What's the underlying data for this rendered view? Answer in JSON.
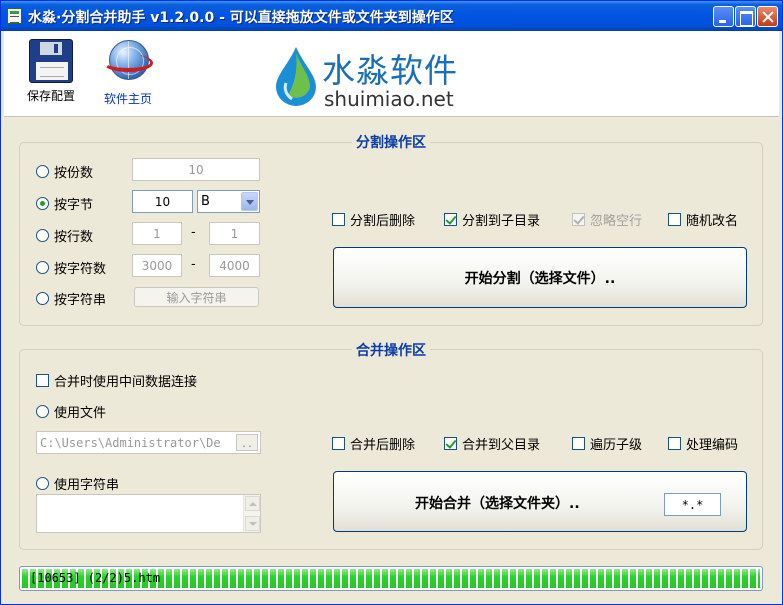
{
  "window": {
    "title": "水淼·分割合并助手 v1.2.0.0 - 可以直接拖放文件或文件夹到操作区"
  },
  "toolbar": {
    "save_label": "保存配置",
    "home_label": "软件主页",
    "save_icon": "floppy-disk-icon",
    "home_icon": "globe-icon"
  },
  "logo": {
    "brand": "水淼软件",
    "domain": "shuimiao.net"
  },
  "split": {
    "title": "分割操作区",
    "by_parts": {
      "label": "按份数",
      "value": "10"
    },
    "by_bytes": {
      "label": "按字节",
      "value": "10",
      "unit": "B"
    },
    "by_lines": {
      "label": "按行数",
      "from": "1",
      "to": "1"
    },
    "by_chars": {
      "label": "按字符数",
      "from": "3000",
      "to": "4000"
    },
    "by_string": {
      "label": "按字符串",
      "button": "输入字符串"
    },
    "selected_mode": "按字节",
    "options": [
      {
        "label": "分割后删除",
        "checked": false,
        "disabled": false
      },
      {
        "label": "分割到子目录",
        "checked": true,
        "disabled": false
      },
      {
        "label": "忽略空行",
        "checked": true,
        "disabled": true
      },
      {
        "label": "随机改名",
        "checked": false,
        "disabled": false
      }
    ],
    "start_button": "开始分割（选择文件）.."
  },
  "merge": {
    "title": "合并操作区",
    "intermediate_label": "合并时使用中间数据连接",
    "intermediate_checked": false,
    "use_file_label": "使用文件",
    "file_path": "C:\\Users\\Administrator\\De",
    "browse_label": "..",
    "use_string_label": "使用字符串",
    "string_value": "",
    "options": [
      {
        "label": "合并后删除",
        "checked": false
      },
      {
        "label": "合并到父目录",
        "checked": true
      },
      {
        "label": "遍历子级",
        "checked": false
      },
      {
        "label": "处理编码",
        "checked": false
      }
    ],
    "start_button": "开始合并（选择文件夹）..",
    "pattern": "*.*"
  },
  "status": {
    "text": "[10653] (2/2)5.htm",
    "progress": 1.0,
    "accent": "#2cd12c"
  }
}
